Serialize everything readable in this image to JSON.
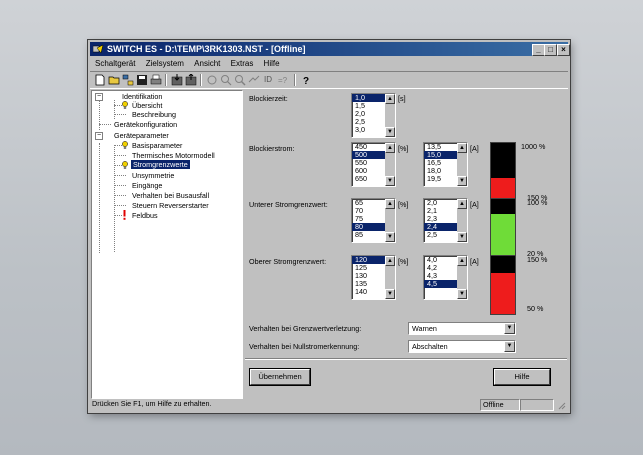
{
  "window": {
    "title": "SWITCH ES - D:\\TEMP\\3RK1303.NST - [Offline]"
  },
  "menubar": [
    "Schaltgerät",
    "Zielsystem",
    "Ansicht",
    "Extras",
    "Hilfe"
  ],
  "toolbar": {
    "id_label": "ID",
    "help_label": "?"
  },
  "tree": {
    "identifikation": "Identifikation",
    "uebersicht": "Übersicht",
    "beschreibung": "Beschreibung",
    "geraetekonfiguration": "Gerätekonfiguration",
    "geraeteparameter": "Geräteparameter",
    "basisparameter": "Basisparameter",
    "thermisches_motormodell": "Thermisches Motormodell",
    "stromgrenzwerte": "Stromgrenzwerte",
    "unsymmetrie": "Unsymmetrie",
    "eingaenge": "Eingänge",
    "verhalten_busausfall": "Verhalten bei Busausfall",
    "steuern_reverserstarter": "Steuern Reverserstarter",
    "feldbus": "Feldbus"
  },
  "panel": {
    "blockierzeit": {
      "label": "Blockierzeit:",
      "values": [
        "1,0",
        "1,5",
        "2,0",
        "2,5",
        "3,0"
      ],
      "selected_index": 0,
      "unit": "[s]"
    },
    "blockierstrom": {
      "label": "Blockierstrom:",
      "percent_values": [
        "450",
        "500",
        "550",
        "600",
        "650"
      ],
      "percent_selected": 1,
      "percent_unit": "[%]",
      "amp_values": [
        "13,5",
        "15,0",
        "16,5",
        "18,0",
        "19,5"
      ],
      "amp_selected": 1,
      "amp_unit": "[A]",
      "bar_top": "1000 %",
      "bar_bottom": "150 %",
      "bar_fill_fraction": 0.4,
      "bar_color": "#ee1c1c"
    },
    "unterer": {
      "label": "Unterer Stromgrenzwert:",
      "percent_values": [
        "65",
        "70",
        "75",
        "80",
        "85"
      ],
      "percent_selected": 3,
      "percent_unit": "[%]",
      "amp_values": [
        "2,0",
        "2,1",
        "2,3",
        "2,4",
        "2,5"
      ],
      "amp_selected": 3,
      "amp_unit": "[A]",
      "bar_top": "100 %",
      "bar_bottom": "20 %",
      "bar_fill_fraction": 0.75,
      "bar_color": "#6fdc38"
    },
    "oberer": {
      "label": "Oberer Stromgrenzwert:",
      "percent_values": [
        "120",
        "125",
        "130",
        "135",
        "140"
      ],
      "percent_selected": 0,
      "percent_unit": "[%]",
      "amp_values": [
        "4,0",
        "4,2",
        "4,3",
        "4,5"
      ],
      "amp_selected": 3,
      "amp_unit": "[A]",
      "bar_top": "150 %",
      "bar_bottom": "50 %",
      "bar_fill_fraction": 0.7,
      "bar_color": "#ee1c1c"
    },
    "grenzwertverletzung": {
      "label": "Verhalten bei Grenzwertverletzung:",
      "value": "Warnen"
    },
    "nullstromerkennung": {
      "label": "Verhalten bei Nullstromerkennung:",
      "value": "Abschalten"
    },
    "uebernehmen_label": "Übernehmen",
    "hilfe_label": "Hilfe"
  },
  "statusbar": {
    "message": "Drücken Sie F1, um Hilfe zu erhalten.",
    "mode": "Offline"
  },
  "colors": {
    "titlebar": "#0a246a",
    "selection": "#0a246a",
    "bulb": "#f0d000",
    "feldbus_mark": "#e00000"
  }
}
